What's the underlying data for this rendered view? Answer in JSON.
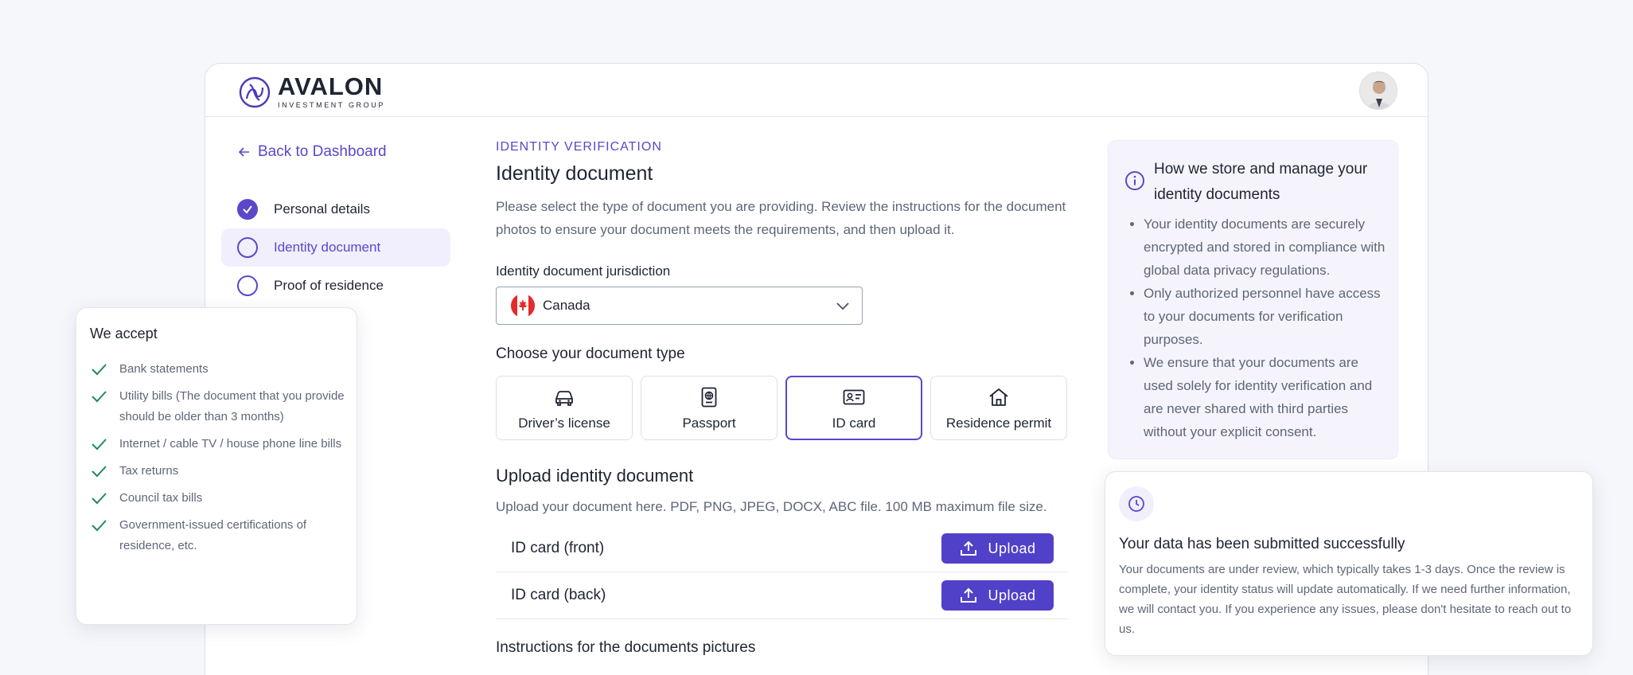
{
  "brand": {
    "name": "AVALON",
    "subtitle": "INVESTMENT GROUP",
    "accent_color": "#5a48c9"
  },
  "nav": {
    "back_label": "Back to Dashboard",
    "back_icon": "arrow-left-icon",
    "steps": [
      {
        "label": "Personal details",
        "state": "done"
      },
      {
        "label": "Identity document",
        "state": "active"
      },
      {
        "label": "Proof of residence",
        "state": "pending"
      }
    ]
  },
  "main": {
    "eyebrow": "IDENTITY VERIFICATION",
    "title": "Identity document",
    "description": "Please select the type of document you are providing. Review the instructions for the document photos to ensure your document meets the requirements, and then upload it.",
    "jurisdiction": {
      "label": "Identity document jurisdiction",
      "value": "Canada",
      "flag_icon": "canada-flag-icon"
    },
    "doc_type_heading": "Choose your document type",
    "doc_types": [
      {
        "label": "Driver’s license",
        "icon": "car-icon",
        "selected": false
      },
      {
        "label": "Passport",
        "icon": "passport-icon",
        "selected": false
      },
      {
        "label": "ID card",
        "icon": "id-card-icon",
        "selected": true
      },
      {
        "label": "Residence permit",
        "icon": "house-icon",
        "selected": false
      }
    ],
    "upload": {
      "heading": "Upload identity document",
      "description": "Upload your document here. PDF, PNG, JPEG, DOCX, ABC file. 100 MB maximum file size.",
      "rows": [
        {
          "label": "ID card (front)",
          "button": "Upload"
        },
        {
          "label": "ID card (back)",
          "button": "Upload"
        }
      ]
    },
    "instructions_heading": "Instructions for the documents pictures"
  },
  "info": {
    "title": "How we store and manage your identity documents",
    "items": [
      "Your identity documents are securely encrypted and stored in compliance with global data privacy regulations.",
      "Only authorized personnel have access to your documents for verification purposes.",
      "We ensure that your documents are used solely for identity verification and are never shared with third parties without your explicit consent."
    ]
  },
  "accept": {
    "title": "We accept",
    "check_color": "#1f8a5b",
    "items": [
      "Bank statements",
      "Utility bills (The document that you provide should be older than 3 months)",
      "Internet / cable TV / house phone line bills",
      "Tax returns",
      "Council tax bills",
      "Government-issued certifications of residence, etc."
    ]
  },
  "success": {
    "title": "Your data has been submitted successfully",
    "text": "Your documents are under review, which typically takes 1-3 days. Once the review is complete, your identity status will update automatically. If we need further information, we will contact you. If you experience any issues, please don't hesitate to reach out to us."
  }
}
